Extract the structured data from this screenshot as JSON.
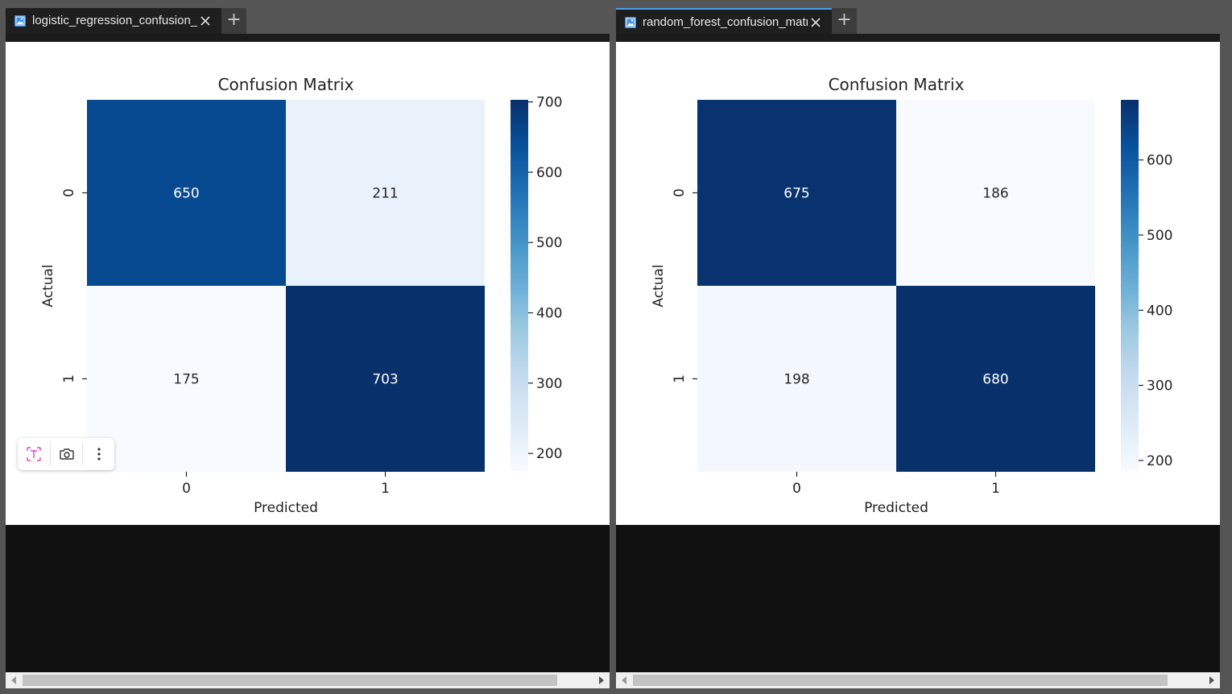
{
  "panes": [
    {
      "tab": {
        "label": "logistic_regression_confusion_matrix.png"
      },
      "chart_data": {
        "type": "heatmap",
        "title": "Confusion Matrix",
        "xlabel": "Predicted",
        "ylabel": "Actual",
        "x_categories": [
          "0",
          "1"
        ],
        "y_categories": [
          "0",
          "1"
        ],
        "values": [
          [
            650,
            211
          ],
          [
            175,
            703
          ]
        ],
        "colormap": "Blues",
        "colorbar_range": [
          175,
          703
        ],
        "colorbar_ticks": [
          700,
          600,
          500,
          400,
          300,
          200
        ]
      }
    },
    {
      "tab": {
        "label": "random_forest_confusion_matrix.png"
      },
      "chart_data": {
        "type": "heatmap",
        "title": "Confusion Matrix",
        "xlabel": "Predicted",
        "ylabel": "Actual",
        "x_categories": [
          "0",
          "1"
        ],
        "y_categories": [
          "0",
          "1"
        ],
        "values": [
          [
            675,
            186
          ],
          [
            198,
            680
          ]
        ],
        "colormap": "Blues",
        "colorbar_range": [
          186,
          680
        ],
        "colorbar_ticks": [
          600,
          500,
          400,
          300,
          200
        ]
      }
    }
  ],
  "toolbar": {
    "icons": [
      "text-select-icon",
      "camera-icon",
      "more-vertical-icon"
    ],
    "accent": "#e040c8"
  },
  "colors": {
    "tab_active_border": "#4a9eea",
    "image_icon": "#3a8ee6"
  }
}
